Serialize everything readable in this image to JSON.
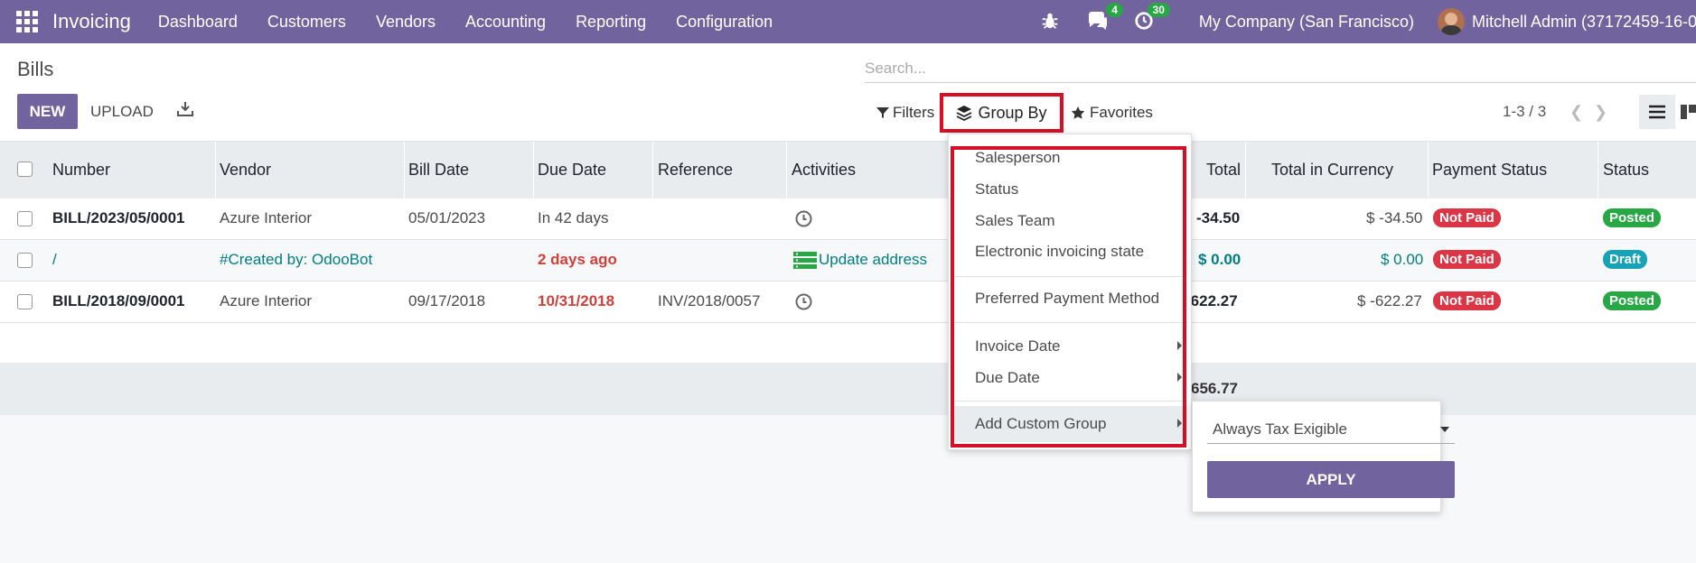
{
  "navbar": {
    "app_name": "Invoicing",
    "menu": [
      "Dashboard",
      "Customers",
      "Vendors",
      "Accounting",
      "Reporting",
      "Configuration"
    ],
    "messages_count": "4",
    "activities_count": "30",
    "company": "My Company (San Francisco)",
    "user": "Mitchell Admin (37172459-16-0"
  },
  "control_panel": {
    "breadcrumb": "Bills",
    "new_label": "NEW",
    "upload_label": "UPLOAD",
    "search_placeholder": "Search...",
    "filters_label": "Filters",
    "groupby_label": "Group By",
    "favorites_label": "Favorites",
    "pager": "1-3 / 3"
  },
  "table": {
    "headers": {
      "number": "Number",
      "vendor": "Vendor",
      "bill_date": "Bill Date",
      "due_date": "Due Date",
      "reference": "Reference",
      "activities": "Activities",
      "total": "Total",
      "total_currency": "Total in Currency",
      "payment_status": "Payment Status",
      "status": "Status"
    },
    "rows": [
      {
        "number": "BILL/2023/05/0001",
        "vendor": "Azure Interior",
        "bill_date": "05/01/2023",
        "due_date": "In 42 days",
        "reference": "",
        "activity": "",
        "total": "-34.50",
        "total_currency": "$ -34.50",
        "payment_status": "Not Paid",
        "status": "Posted"
      },
      {
        "number": "/",
        "vendor": "#Created by: OdooBot",
        "bill_date": "",
        "due_date": "2 days ago",
        "reference": "",
        "activity": "Update address",
        "total": "$ 0.00",
        "total_currency": "$ 0.00",
        "payment_status": "Not Paid",
        "status": "Draft"
      },
      {
        "number": "BILL/2018/09/0001",
        "vendor": "Azure Interior",
        "bill_date": "09/17/2018",
        "due_date": "10/31/2018",
        "reference": "INV/2018/0057",
        "activity": "",
        "total": "-622.27",
        "total_currency": "$ -622.27",
        "payment_status": "Not Paid",
        "status": "Posted"
      }
    ],
    "footer_total": "656.77"
  },
  "groupby_menu": {
    "items": [
      "Salesperson",
      "Status",
      "Sales Team",
      "Electronic invoicing state"
    ],
    "payment_method": "Preferred Payment Method",
    "invoice_date": "Invoice Date",
    "due_date": "Due Date",
    "custom_group": "Add Custom Group"
  },
  "custom_group": {
    "selected_field": "Always Tax Exigible",
    "apply_label": "APPLY"
  },
  "colors": {
    "brand": "#71639e",
    "highlight": "#d50f25",
    "link": "#017e84",
    "danger": "#dc3545",
    "success": "#28a745",
    "info": "#17a2b8"
  }
}
